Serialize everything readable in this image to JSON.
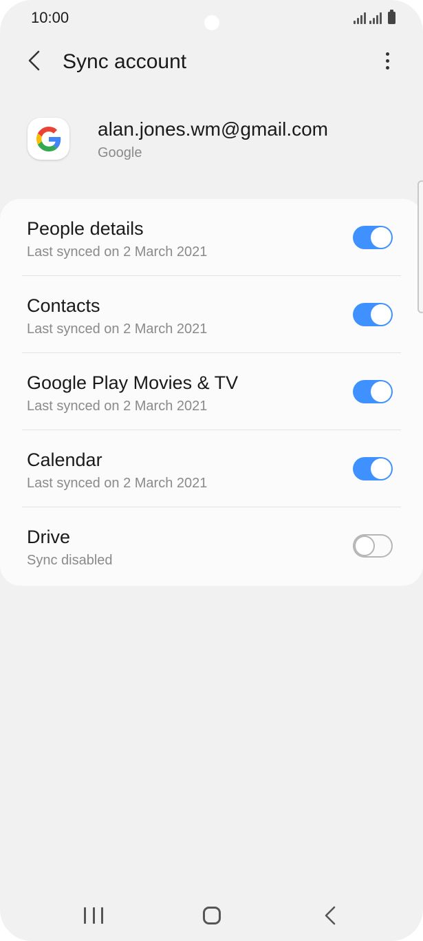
{
  "status_bar": {
    "time": "10:00"
  },
  "header": {
    "title": "Sync account",
    "back_icon": "chevron-left-icon",
    "more_icon": "more-vert-icon"
  },
  "account": {
    "email": "alan.jones.wm@gmail.com",
    "type": "Google",
    "icon": "google-logo-icon"
  },
  "sync_items": [
    {
      "title": "People details",
      "subtitle": "Last synced on 2 March 2021",
      "enabled": true
    },
    {
      "title": "Contacts",
      "subtitle": "Last synced on 2 March 2021",
      "enabled": true
    },
    {
      "title": "Google Play Movies & TV",
      "subtitle": "Last synced on 2 March 2021",
      "enabled": true
    },
    {
      "title": "Calendar",
      "subtitle": "Last synced on 2 March 2021",
      "enabled": true
    },
    {
      "title": "Drive",
      "subtitle": "Sync disabled",
      "enabled": false
    }
  ],
  "colors": {
    "toggle_on": "#3e91ff",
    "background": "#f1f1f1",
    "card": "#fbfbfb"
  },
  "nav_bar": {
    "recent_icon": "recent-apps-icon",
    "home_icon": "home-icon",
    "back_icon": "back-icon"
  }
}
